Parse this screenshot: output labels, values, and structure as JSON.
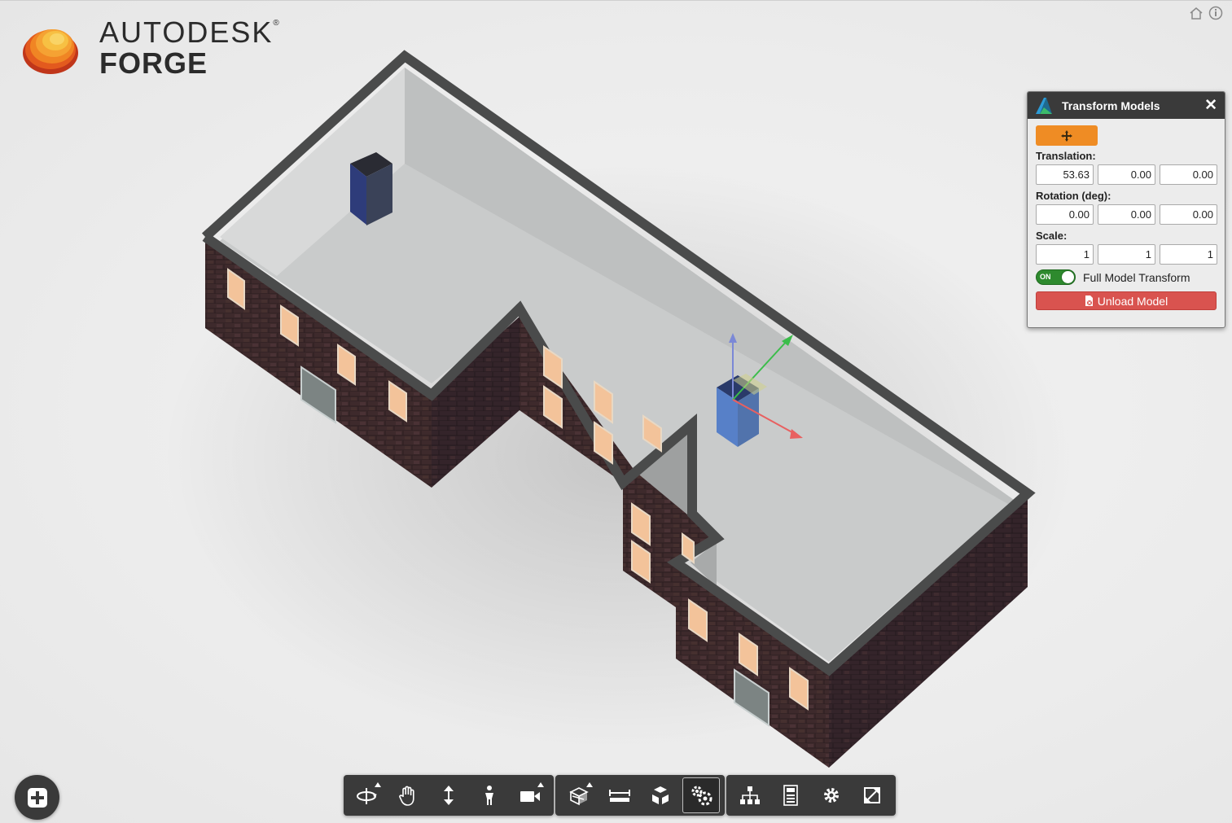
{
  "logo": {
    "line1": "AUTODESK",
    "registered": "®",
    "line2": "FORGE"
  },
  "top_icons": [
    "home-icon",
    "info-icon"
  ],
  "panel": {
    "title": "Transform Models",
    "close_label": "✕",
    "move_tool_icon": "move-icon",
    "translation_label": "Translation:",
    "translation": [
      "53.63",
      "0.00",
      "0.00"
    ],
    "rotation_label": "Rotation (deg):",
    "rotation": [
      "0.00",
      "0.00",
      "0.00"
    ],
    "scale_label": "Scale:",
    "scale": [
      "1",
      "1",
      "1"
    ],
    "toggle_state": "ON",
    "toggle_label": "Full Model Transform",
    "unload_label": "Unload Model",
    "accent_color": "#ef8c24",
    "unload_color": "#d9534f"
  },
  "toolbar": {
    "navigation": [
      "orbit-icon",
      "pan-icon",
      "dolly-icon",
      "first-person-icon",
      "camera-icon"
    ],
    "modeling": [
      "section-icon",
      "measure-icon",
      "explode-icon",
      "transform-extension-icon"
    ],
    "settings": [
      "model-browser-icon",
      "properties-icon",
      "settings-icon",
      "fullscreen-icon"
    ]
  },
  "add_button_icon": "plus-icon"
}
